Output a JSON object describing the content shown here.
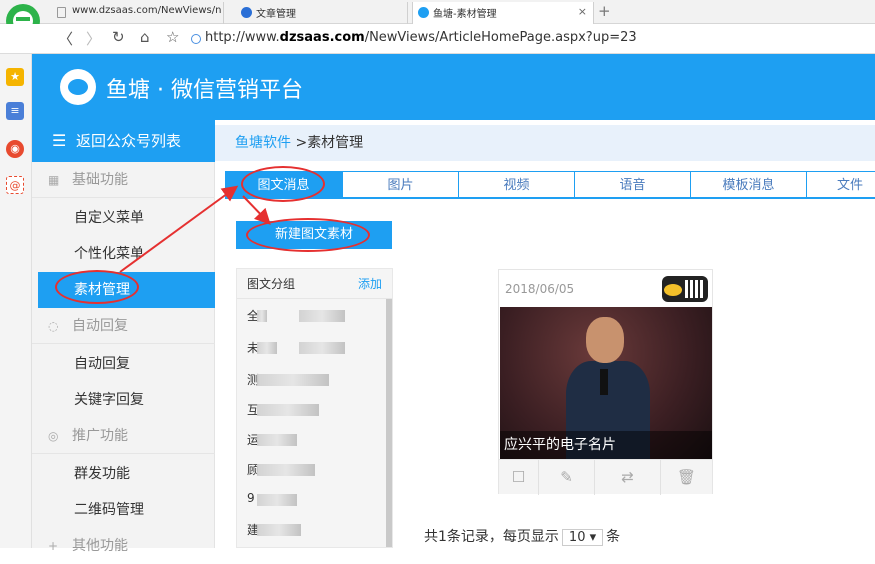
{
  "browser": {
    "tabs": [
      {
        "title": "www.dzsaas.com/NewViews/n"
      },
      {
        "title": "文章管理"
      },
      {
        "title": "鱼塘-素材管理",
        "close": "×"
      }
    ],
    "new_tab": "+",
    "url_prefix": "http://www.",
    "url_domain": "dzsaas.com",
    "url_path": "/NewViews/ArticleHomePage.aspx?up=23",
    "nav": {
      "back": "〈",
      "forward": "〉",
      "refresh": "↻",
      "home": "⌂",
      "favorite": "☆"
    }
  },
  "app": {
    "title": "鱼塘 · 微信营销平台"
  },
  "sidebar": {
    "back_label": "返回公众号列表",
    "groups": [
      {
        "label": "基础功能",
        "items": [
          "自定义菜单",
          "个性化菜单",
          "素材管理"
        ]
      },
      {
        "label": "自动回复",
        "items": [
          "自动回复",
          "关键字回复"
        ]
      },
      {
        "label": "推广功能",
        "items": [
          "群发功能",
          "二维码管理"
        ]
      },
      {
        "label": "其他功能",
        "items": []
      }
    ],
    "active_item": "素材管理"
  },
  "breadcrumb": {
    "root": "鱼塘软件",
    "separator": " >",
    "current": "素材管理"
  },
  "tabs": [
    "图文消息",
    "图片",
    "视频",
    "语音",
    "模板消息",
    "文件"
  ],
  "active_tab": "图文消息",
  "new_button": "新建图文素材",
  "group_panel": {
    "title": "图文分组",
    "add": "添加",
    "rows": [
      "全",
      "未",
      "测",
      "互",
      "运",
      "顾",
      "9",
      "建"
    ]
  },
  "article": {
    "date": "2018/06/05",
    "caption": "应兴平的电子名片"
  },
  "pagination": {
    "prefix": "共1条记录，每页显示",
    "page_size": "10",
    "suffix": "条"
  },
  "colors": {
    "primary": "#1e9ff2",
    "annotation": "#e53030"
  }
}
